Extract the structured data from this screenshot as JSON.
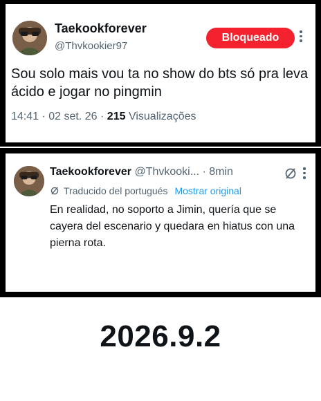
{
  "tweet1": {
    "display_name": "Taekookforever",
    "handle": "@Thvkookier97",
    "badge": "Bloqueado",
    "text": "Sou solo mais vou ta no show do bts só pra leva ácido e jogar no pingmin",
    "time": "14:41",
    "date": "02 set. 26",
    "views_count": "215",
    "views_label": "Visualizações",
    "separator": "·"
  },
  "tweet2": {
    "display_name": "Taekookforever",
    "handle": "@Thvkooki...",
    "time": "· 8min",
    "translated_note": "Traducido del portugués",
    "show_original": "Mostrar original",
    "text": "En realidad, no soporto a Jimin, quería que se cayera del escenario y quedara en hiatus con una pierna rota."
  },
  "caption": "2026.9.2",
  "colors": {
    "badge_bg": "#f4212e",
    "link": "#1d9bf0",
    "muted": "#536471"
  },
  "icons": [
    "avatar",
    "more-options-icon",
    "translate-icon"
  ]
}
